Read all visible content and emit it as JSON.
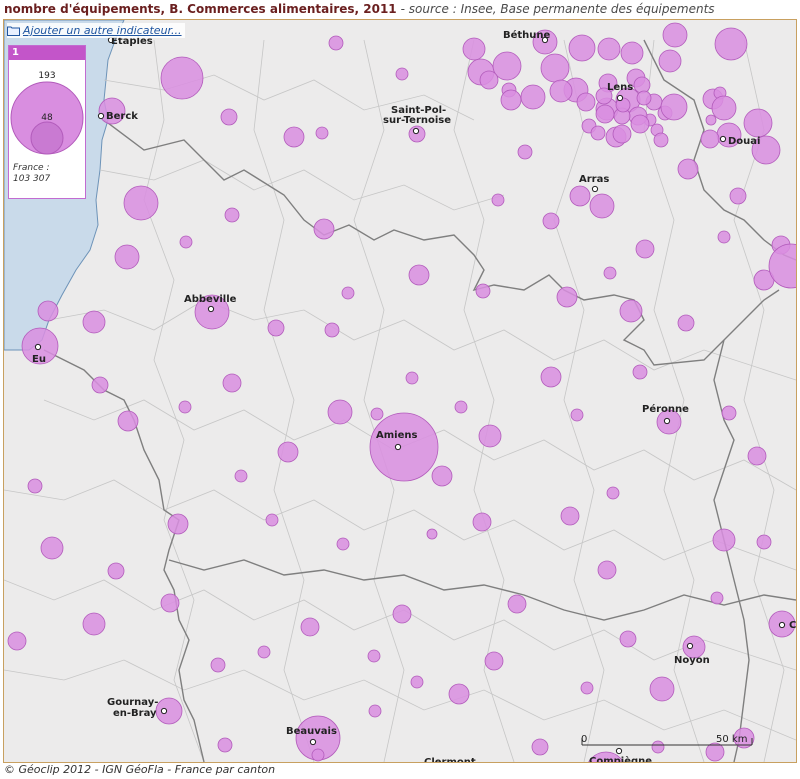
{
  "title": {
    "main": "nombre d'équipements, B. Commerces alimentaires, 2011",
    "source": "- source : Insee, Base permanente des équipements"
  },
  "toolbar": {
    "add_indicator_label": "Ajouter un autre indicateur..."
  },
  "legend": {
    "number": "1",
    "value_large": "193",
    "value_small": "48",
    "france_label": "France :",
    "france_value": "103 307"
  },
  "scale": {
    "zero": "0",
    "fifty": "50 km"
  },
  "footer": "© Géoclip 2012 - IGN GéoFla - France par canton",
  "colors": {
    "bubble_fill": "#d98ee0",
    "bubble_stroke": "#b25bbb",
    "sea": "#c9daea",
    "land": "#ecebeb",
    "border": "#7f7f7f"
  },
  "cities": [
    {
      "name": "Etaples"
    },
    {
      "name": "Béthune"
    },
    {
      "name": "Lens"
    },
    {
      "name": "Berck"
    },
    {
      "name": "Saint-Pol-"
    },
    {
      "name": "sur-Ternoise"
    },
    {
      "name": "Douai"
    },
    {
      "name": "Arras"
    },
    {
      "name": "Abbeville"
    },
    {
      "name": "Eu"
    },
    {
      "name": "Péronne"
    },
    {
      "name": "Amiens"
    },
    {
      "name": "Noyon"
    },
    {
      "name": "Gournay-"
    },
    {
      "name": "en-Bray"
    },
    {
      "name": "Beauvais"
    },
    {
      "name": "Clermont"
    },
    {
      "name": "Compiègne"
    },
    {
      "name": "C"
    }
  ]
}
